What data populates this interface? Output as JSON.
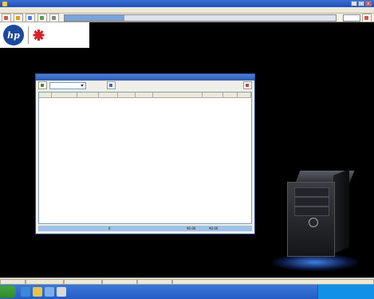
{
  "window": {
    "title": "",
    "btn_min": "_",
    "btn_max": "□",
    "btn_close": "×"
  },
  "menu": [
    "",
    "",
    "",
    "",
    "",
    ""
  ],
  "toolbar": {
    "buttons": [
      {
        "label": "",
        "icon": "exit-icon",
        "color": "#d9534f"
      },
      {
        "label": "",
        "icon": "cart-icon",
        "color": "#e0a020"
      },
      {
        "label": "",
        "icon": "calculator-icon",
        "color": "#4a7fd1"
      },
      {
        "label": "",
        "icon": "notepad-icon",
        "color": "#5aa04a"
      },
      {
        "label": "",
        "icon": "lock-icon",
        "color": "#888888"
      }
    ],
    "progress_text": "",
    "progress_fraction": 0.22,
    "right_label": "",
    "help_label": ""
  },
  "brand": {
    "hp": "hp",
    "company": ""
  },
  "dialog": {
    "title": "",
    "select_label": "",
    "days_label": "",
    "query_label": "",
    "close_label": "",
    "columns": [
      "",
      "",
      "",
      "",
      "",
      "",
      "",
      "",
      "",
      ""
    ],
    "footer": {
      "label": "",
      "count": "0",
      "total1": "¥0.00",
      "total2": "¥0.00"
    }
  },
  "watermark": {
    "line1": "",
    "line2": ""
  },
  "statusbar": [
    "",
    "",
    "",
    "",
    "",
    ""
  ],
  "taskbar": {
    "start": "",
    "tray": ""
  }
}
